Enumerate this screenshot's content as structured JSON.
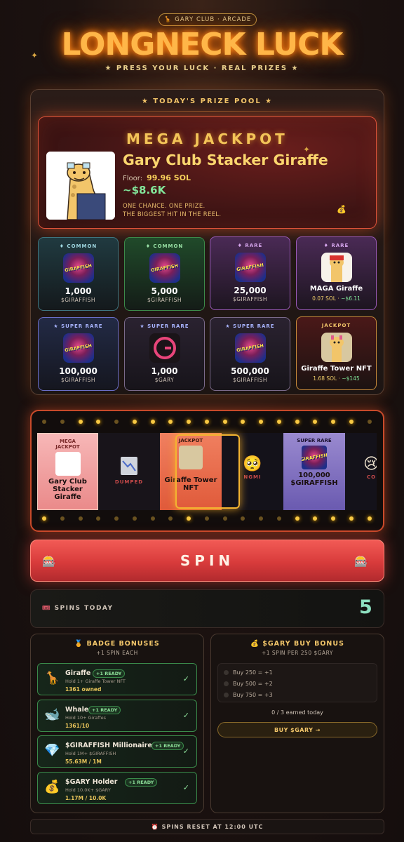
{
  "header": {
    "club_label": "GARY CLUB · ARCADE",
    "title": "LONGNECK LUCK",
    "subtitle": "★ PRESS YOUR LUCK · REAL PRIZES ★"
  },
  "prize_pool": {
    "title": "★ TODAY'S PRIZE POOL ★",
    "mega": {
      "label": "MEGA JACKPOT",
      "name": "Gary Club Stacker Giraffe",
      "floor_label": "Floor:",
      "floor_value": "99.96 SOL",
      "usd": "~$8.6K",
      "tagline1": "ONE CHANCE. ONE PRIZE.",
      "tagline2": "THE BIGGEST HIT IN THE REEL."
    },
    "tiles": [
      {
        "rarity": "♦ COMMON",
        "amount": "1,000",
        "unit": "$GIRAFFISH"
      },
      {
        "rarity": "♦ COMMON",
        "amount": "5,000",
        "unit": "$GIRAFFISH"
      },
      {
        "rarity": "♦ RARE",
        "amount": "25,000",
        "unit": "$GIRAFFISH"
      },
      {
        "rarity": "♦ RARE",
        "name": "MAGA Giraffe",
        "sol": "0.07 SOL",
        "usd": "~$6.11"
      },
      {
        "rarity": "★ SUPER RARE",
        "amount": "100,000",
        "unit": "$GIRAFFISH"
      },
      {
        "rarity": "★ SUPER RARE",
        "amount": "1,000",
        "unit": "$GARY"
      },
      {
        "rarity": "★ SUPER RARE",
        "amount": "500,000",
        "unit": "$GIRAFFISH"
      },
      {
        "rarity": "JACKPOT",
        "name": "Giraffe Tower NFT",
        "sol": "1.68 SOL",
        "usd": "~$145"
      }
    ]
  },
  "reel": {
    "cards": [
      {
        "tag1": "MEGA",
        "tag2": "JACKPOT",
        "name1": "Gary Club",
        "name2": "Stacker",
        "name3": "Giraffe"
      },
      {
        "label": "DUMPED"
      },
      {
        "tag1": "JACKPOT",
        "name1": "Giraffe Tower",
        "name2": "NFT"
      },
      {
        "label": "NGMI"
      },
      {
        "tag1": "SUPER RARE",
        "name1": "100,000",
        "name2": "$GIRAFFISH"
      },
      {
        "label": "CO"
      }
    ]
  },
  "spin": {
    "label": "SPIN"
  },
  "spins_today": {
    "label": "SPINS TODAY",
    "value": "5"
  },
  "badge_bonuses": {
    "title": "BADGE BONUSES",
    "subtitle": "+1 SPIN EACH",
    "ready_label": "+1 READY",
    "items": [
      {
        "name": "Giraffe",
        "desc": "Hold 1+ Giraffe Tower NFT",
        "progress": "1361 owned"
      },
      {
        "name": "Whale",
        "desc": "Hold 10+ Giraffes",
        "progress": "1361/10"
      },
      {
        "name": "$GIRAFFISH Millionaire",
        "desc": "Hold 1M+ $GIRAFFISH",
        "progress": "55.63M / 1M"
      },
      {
        "name": "$GARY Holder",
        "desc": "Hold 10.0K+ $GARY",
        "progress": "1.17M / 10.0K"
      }
    ]
  },
  "buy_bonus": {
    "title": "$GARY BUY BONUS",
    "subtitle": "+1 SPIN PER 250 $GARY",
    "tiers": [
      "Buy 250 = +1",
      "Buy 500 = +2",
      "Buy 750 = +3"
    ],
    "earned": "0 / 3 earned today",
    "button": "BUY $GARY →"
  },
  "footer": {
    "reset": "SPINS RESET AT 12:00 UTC"
  }
}
